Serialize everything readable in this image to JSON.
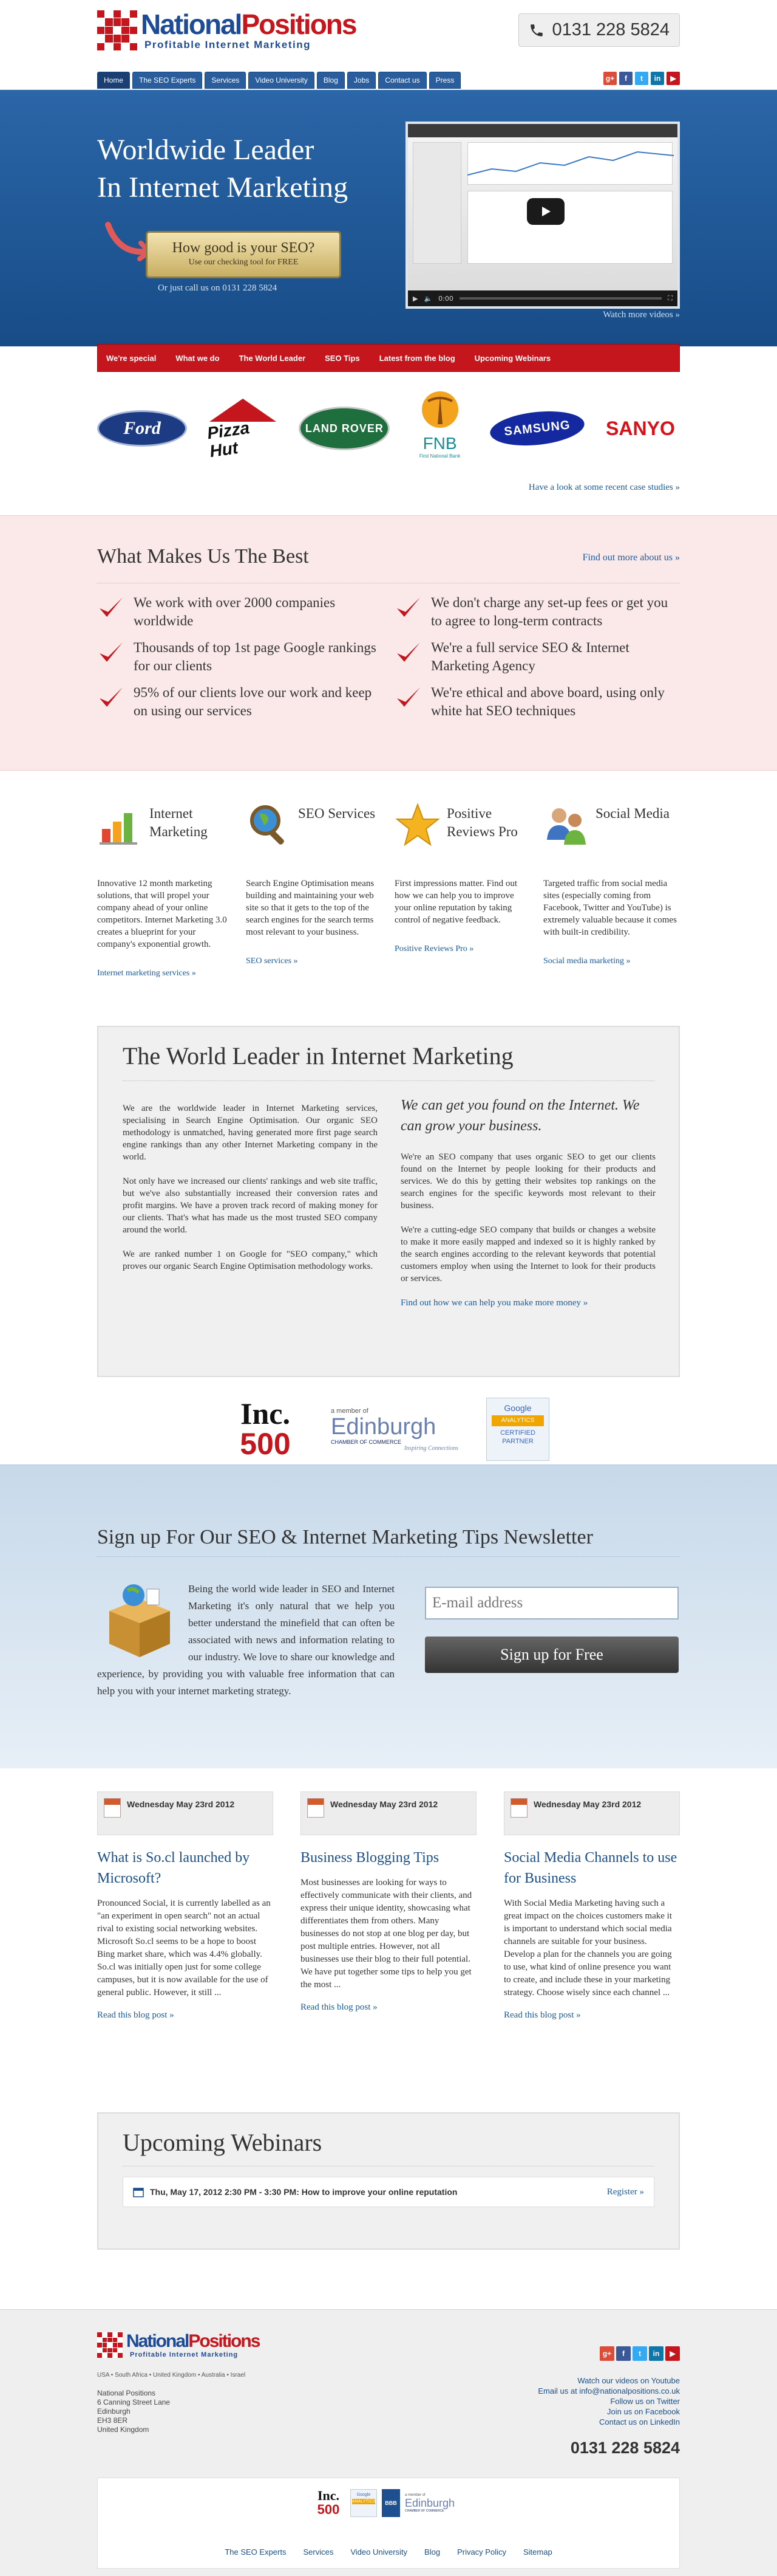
{
  "header": {
    "logo_name_1": "National",
    "logo_name_2": "Positions",
    "logo_tagline": "Profitable Internet Marketing",
    "phone": "0131 228 5824",
    "nav": [
      "Home",
      "The SEO Experts",
      "Services",
      "Video University",
      "Blog",
      "Jobs",
      "Contact us",
      "Press"
    ],
    "social": [
      {
        "icon": "google-plus-icon",
        "glyph": "g+",
        "color": "#dd4b39"
      },
      {
        "icon": "facebook-icon",
        "glyph": "f",
        "color": "#3b5998"
      },
      {
        "icon": "twitter-icon",
        "glyph": "t",
        "color": "#33aaf3"
      },
      {
        "icon": "linkedin-icon",
        "glyph": "in",
        "color": "#0e76a8"
      },
      {
        "icon": "youtube-icon",
        "glyph": "▶",
        "color": "#c4161c"
      }
    ]
  },
  "hero": {
    "title_line1": "Worldwide Leader",
    "title_line2": "In Internet Marketing",
    "seo_button_title": "How good is your SEO?",
    "seo_button_sub": "Use our checking tool for FREE",
    "call_text": "Or just call us on 0131 228 5824",
    "video_time": "0:00",
    "watch_more": "Watch more videos »"
  },
  "red_nav": [
    "We're special",
    "What we do",
    "The World Leader",
    "SEO Tips",
    "Latest from the blog",
    "Upcoming Webinars"
  ],
  "clients": {
    "logos": [
      "Ford",
      "Pizza Hut",
      "Land Rover",
      "FNB",
      "Samsung",
      "Sanyo"
    ],
    "fnb_sub": "First National Bank",
    "case_link": "Have a look at some recent case studies »"
  },
  "best": {
    "title": "What Makes Us The Best",
    "find_link": "Find out more about us »",
    "items": [
      "We work with over 2000 companies worldwide",
      "We don't charge any set-up fees or get you to agree to long-term contracts",
      "Thousands of top 1st page Google rankings for our clients",
      "We're a full service SEO & Internet Marketing Agency",
      "95% of our clients love our work and keep on using our services",
      "We're ethical and above board, using only white hat SEO techniques"
    ]
  },
  "services": [
    {
      "title": "Internet Marketing",
      "text": "Innovative 12 month marketing solutions, that will propel your company ahead of your online competitors. Internet Marketing 3.0 creates a blueprint for your company's exponential growth.",
      "link": "Internet marketing services »"
    },
    {
      "title": "SEO Services",
      "text": "Search Engine Optimisation means building and maintaining your web site so that it gets to the top of the search engines for the search terms most relevant to your business.",
      "link": "SEO services »"
    },
    {
      "title": "Positive Reviews Pro",
      "text": "First impressions matter. Find out how we can help you to improve your online reputation by taking control of negative feedback.",
      "link": "Positive Reviews Pro »"
    },
    {
      "title": "Social Media",
      "text": "Targeted traffic from social media sites (especially coming from Facebook, Twitter and YouTube) is extremely valuable because it comes with built-in credibility.",
      "link": "Social media marketing »"
    }
  ],
  "leader": {
    "title": "The World Leader in Internet Marketing",
    "left_p1": "We are the worldwide leader in Internet Marketing services, specialising in Search Engine Optimisation. Our organic SEO methodology is unmatched, having generated more first page search engine rankings than any other Internet Marketing company in the world.",
    "left_p2": "Not only have we increased our clients' rankings and web site traffic, but we've also substantially increased their conversion rates and profit margins. We have a proven track record of making money for our clients. That's what has made us the most trusted SEO company around the world.",
    "left_p3": "We are ranked number 1 on Google for \"SEO company,\" which proves our organic Search Engine Optimisation methodology works.",
    "right_em": "We can get you found on the Internet. We can grow your business.",
    "right_p1": "We're an SEO company that uses organic SEO to get our clients found on the Internet by people looking for their products and services. We do this by getting their websites top rankings on the search engines for the specific keywords most relevant to their business.",
    "right_p2": "We're a cutting-edge SEO company that builds or changes a website to make it more easily mapped and indexed so it is highly ranked by the search engines according to the relevant keywords that potential customers employ when using the Internet to look for their products or services.",
    "right_link": "Find out how we can help you make more money »"
  },
  "badges": {
    "inc_top": "Inc.",
    "inc_bottom": "500",
    "edinburgh_pre": "a member of",
    "edinburgh_name": "Edinburgh",
    "edinburgh_sub": "CHAMBER OF COMMERCE",
    "edinburgh_tag": "Inspiring Connections",
    "google_top": "Google",
    "google_product": "ANALYTICS",
    "google_cert": "CERTIFIED PARTNER"
  },
  "newsletter": {
    "title": "Sign up For Our SEO & Internet Marketing Tips Newsletter",
    "text": "Being the world wide leader in SEO and Internet Marketing it's only natural that we help you better understand the minefield that can often be associated with news and information relating to our industry. We love to share our knowledge and experience, by providing you with valuable free information that can help you with your internet marketing strategy.",
    "email_placeholder": "E-mail address",
    "button": "Sign up for Free"
  },
  "blog": [
    {
      "date": "Wednesday May 23rd 2012",
      "title": "What is So.cl launched by Microsoft?",
      "text": "Pronounced Social, it is currently labelled as an \"an experiment in open search\" not an actual rival to existing social networking websites. Microsoft So.cl seems to be a hope to boost Bing market share, which was 4.4% globally. So.cl was initially open just for some college campuses, but it is now available for the use of general public. However, it still ...",
      "link": "Read this blog post »"
    },
    {
      "date": "Wednesday May 23rd 2012",
      "title": "Business Blogging Tips",
      "text": "Most businesses are looking for ways to effectively communicate with their clients, and express their unique identity, showcasing what differentiates them from others. Many businesses do not stop at one blog per day, but post multiple entries. However, not all businesses use their blog to their full potential. We have put together some tips to help you get the most ...",
      "link": "Read this blog post »"
    },
    {
      "date": "Wednesday May 23rd 2012",
      "title": "Social Media Channels to use for Business",
      "text": "With Social Media Marketing having such a great impact on the choices customers make it is important to understand which social media channels are suitable for your business.  Develop a plan for the channels you are going to use, what kind of online presence you want to create, and include these in your marketing strategy. Choose wisely since each channel ...",
      "link": "Read this blog post »"
    }
  ],
  "webinars": {
    "title": "Upcoming Webinars",
    "item": "Thu, May 17, 2012 2:30 PM - 3:30 PM: How to improve your online reputation",
    "register": "Register »"
  },
  "footer": {
    "countries": "USA • South Africa • United Kingdom • Australia • Israel",
    "address": [
      "National Positions",
      "6 Canning Street Lane",
      "Edinburgh",
      "EH3 8ER",
      "United Kingdom"
    ],
    "links": [
      "Watch our videos on Youtube",
      "Email us at info@nationalpositions.co.uk",
      "Follow us on Twitter",
      "Join us on Facebook",
      "Contact us on LinkedIn"
    ],
    "phone": "0131 228 5824",
    "nav": [
      "The SEO Experts",
      "Services",
      "Video University",
      "Blog",
      "Privacy Policy",
      "Sitemap"
    ]
  }
}
